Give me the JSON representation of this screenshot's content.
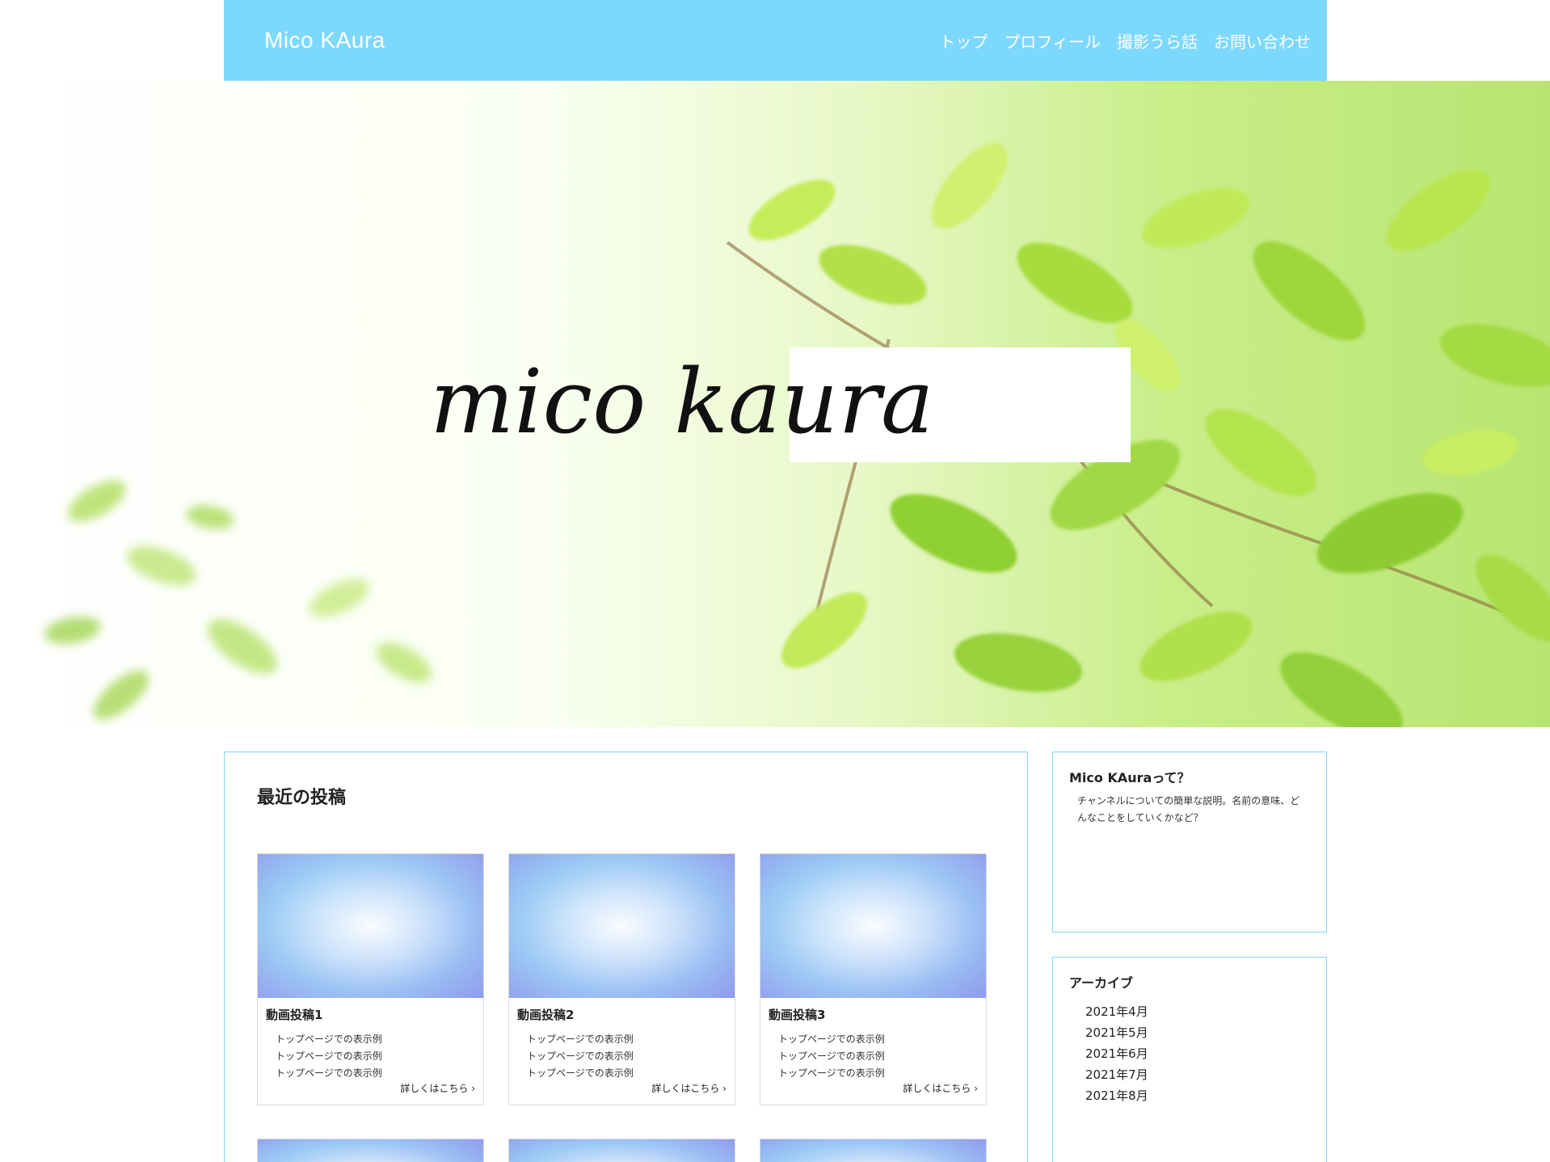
{
  "site": {
    "brand": "Mico KAura",
    "hero_logo_text": "mico kaura"
  },
  "nav": [
    {
      "label": "トップ"
    },
    {
      "label": "プロフィール"
    },
    {
      "label": "撮影うら話"
    },
    {
      "label": "お問い合わせ"
    }
  ],
  "main": {
    "section_title": "最近の投稿",
    "more_label": "詳しくはこちら",
    "more_icon": "chevron-right-icon",
    "posts": [
      {
        "title": "動画投稿1",
        "lines": [
          "トップページでの表示例",
          "トップページでの表示例",
          "トップページでの表示例"
        ]
      },
      {
        "title": "動画投稿2",
        "lines": [
          "トップページでの表示例",
          "トップページでの表示例",
          "トップページでの表示例"
        ]
      },
      {
        "title": "動画投稿3",
        "lines": [
          "トップページでの表示例",
          "トップページでの表示例",
          "トップページでの表示例"
        ]
      }
    ]
  },
  "sidebar": {
    "about": {
      "title": "Mico KAuraって？",
      "text": "チャンネルについての簡単な説明。名前の意味、どんなことをしていくかなど？"
    },
    "archive": {
      "title": "アーカイブ",
      "items": [
        "2021年4月",
        "2021年5月",
        "2021年6月",
        "2021年7月",
        "2021年8月"
      ]
    }
  },
  "colors": {
    "header_bg": "#7dd8fe",
    "border_accent": "#7dd8fe",
    "text": "#222222"
  }
}
